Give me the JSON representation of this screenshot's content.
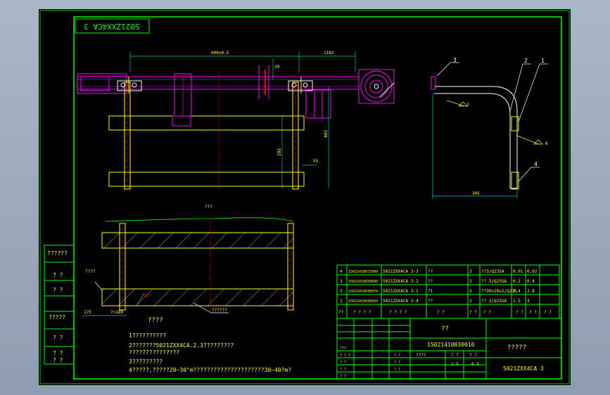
{
  "drawing": {
    "stamp": "5021ZXX4CA 3",
    "side_labels": [
      "??????",
      "? ?",
      "? ?",
      "?????",
      "? ?",
      "? ?",
      "? ?"
    ],
    "dims": {
      "top_left": "600±0.5",
      "top_right": "1182",
      "v_small": "20",
      "v_443": "443",
      "v_295": "295",
      "h_55": "55",
      "side_width": "345",
      "left_175": "175",
      "left_180": "?=180",
      "angle": "45°"
    },
    "callouts": {
      "c3": "3",
      "c2": "2",
      "c1": "1",
      "c4": "4",
      "weld_a": "2",
      "weld_b": "6"
    },
    "labels": {
      "section_title": "???",
      "left_note": "????",
      "bottom_note": "??????",
      "view_label": "????"
    },
    "notes": [
      "1??????????",
      "2???????5021ZXX4CA.2.3?????????",
      "  ???????????????",
      "3?????????",
      "4?????,?????20~30°m?????????????????????30~40?m?"
    ]
  },
  "bom": {
    "rows": [
      [
        "4",
        "15021410071600",
        "5021ZXX4CA 3-3",
        "??",
        "3",
        "??3/Q235A",
        "0.01",
        "0.02"
      ],
      [
        "3",
        "15021410030040",
        "5021ZXX4CA 3-2",
        "??",
        "3",
        "?? 5/Q235A",
        "0.2",
        "0.4"
      ],
      [
        "2",
        "15021410030070",
        "5021ZXX4CA 3-1",
        "?1",
        "3",
        "??30x20x2/Q235",
        "1.4",
        "2.8"
      ],
      [
        "1",
        "15021410030020",
        "5021ZXX4CA 3-4",
        "??",
        "2",
        "?? 2/Q235A",
        "1.5",
        "3"
      ]
    ],
    "header": [
      "??",
      "? ? ? ?",
      "? ? ? ?",
      "? ?",
      "? ?",
      "? ?",
      "? ?",
      "? ?",
      "? ?"
    ]
  },
  "title_block": {
    "material": "??",
    "code": "15021410030010",
    "name": "?????",
    "drawing_no": "5021ZXX4CA 3",
    "scale": "1:5",
    "weight": "6.3",
    "sheet_info": "????",
    "col_a": "? ?",
    "col_b": "? ?",
    "left_rows": [
      "? ? ?",
      "? ?",
      "? ?",
      "? ?",
      "???"
    ],
    "small1": "? ?",
    "small2": "? ?",
    "small3": "? ?"
  }
}
